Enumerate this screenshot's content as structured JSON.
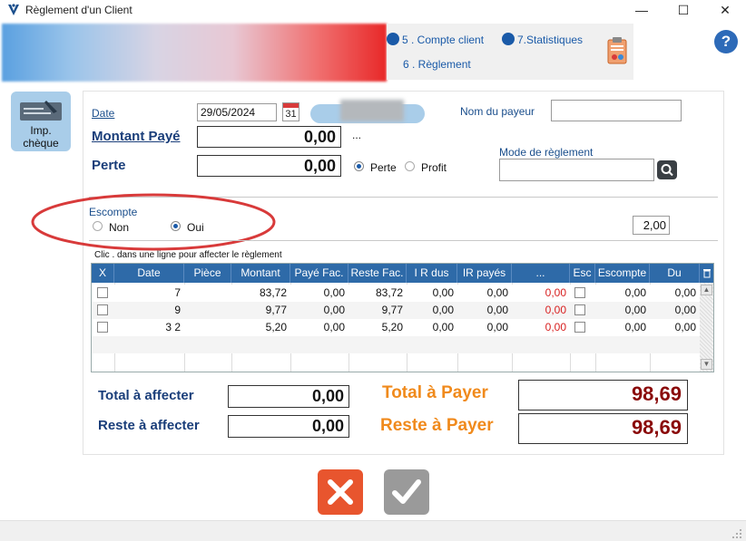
{
  "window": {
    "title": "Règlement d'un  Client",
    "minimize": "—",
    "maximize": "☐",
    "close": "✕"
  },
  "nav": {
    "compte_client": "5 . Compte client",
    "statistiques": "7.Statistiques",
    "reglement": "6 . Règlement"
  },
  "help_label": "?",
  "print_cheque": "Imp. chèque",
  "form": {
    "date_label": "Date",
    "date_value": "29/05/2024",
    "calendar_day": "31",
    "payer_name_label": "Nom du payeur",
    "payer_name_value": "",
    "montant_paye_label": "Montant Payé",
    "montant_paye_value": "0,00",
    "ellipsis": "...",
    "perte_label": "Perte",
    "perte_value": "0,00",
    "radio_perte": "Perte",
    "radio_profit": "Profit",
    "mode_label": "Mode de règlement",
    "mode_value": "",
    "escompte_label": "Escompte",
    "escompte_non": "Non",
    "escompte_oui": "Oui",
    "escompte_value": "2,00",
    "hint": "Clic . dans une ligne pour affecter le règlement"
  },
  "table": {
    "columns": [
      "X",
      "Date",
      "Pièce",
      "Montant",
      "Payé Fac.",
      "Reste Fac.",
      "I R  dus",
      "IR  payés",
      "...",
      "Esc",
      "Escompte",
      "Du"
    ],
    "rows": [
      {
        "date": "7",
        "piece": "",
        "montant": "83,72",
        "paye": "0,00",
        "reste": "83,72",
        "ir_dus": "0,00",
        "ir_payes": "0,00",
        "dots": "0,00",
        "escompte": "0,00",
        "du": "0,00"
      },
      {
        "date": "9",
        "piece": "",
        "montant": "9,77",
        "paye": "0,00",
        "reste": "9,77",
        "ir_dus": "0,00",
        "ir_payes": "0,00",
        "dots": "0,00",
        "escompte": "0,00",
        "du": "0,00"
      },
      {
        "date": "3 2",
        "piece": "",
        "montant": "5,20",
        "paye": "0,00",
        "reste": "5,20",
        "ir_dus": "0,00",
        "ir_payes": "0,00",
        "dots": "0,00",
        "escompte": "0,00",
        "du": "0,00"
      }
    ]
  },
  "totals": {
    "total_affecter_label": "Total à affecter",
    "total_affecter_value": "0,00",
    "reste_affecter_label": "Reste à affecter",
    "reste_affecter_value": "0,00",
    "total_payer_label": "Total à Payer",
    "total_payer_value": "98,69",
    "reste_payer_label": "Reste à Payer",
    "reste_payer_value": "98,69"
  },
  "colors": {
    "accent_blue": "#2e6aa8",
    "amount_red": "#8a0a0a",
    "orange": "#f08a1c",
    "annotation_red": "#d83a3a",
    "cancel": "#e8552e"
  }
}
